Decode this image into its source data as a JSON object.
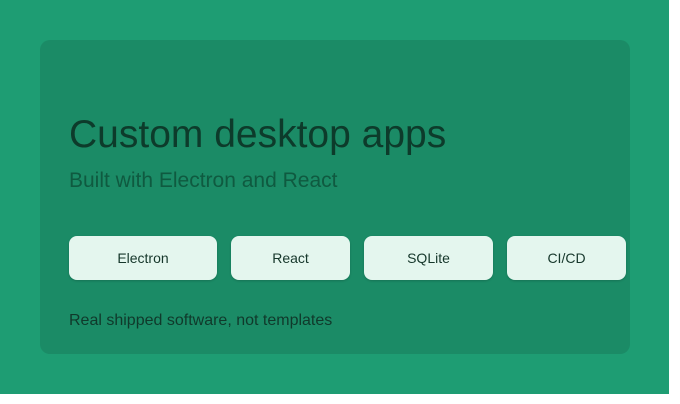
{
  "hero": {
    "title": "Custom desktop apps",
    "subtitle": "Built with Electron and React",
    "tags": [
      {
        "label": "Electron"
      },
      {
        "label": "React"
      },
      {
        "label": "SQLite"
      },
      {
        "label": "CI/CD"
      }
    ],
    "footnote": "Real shipped software, not templates"
  },
  "colors": {
    "background": "#1e9d73",
    "card": "#1b8b66",
    "chip": "#e4f6ee",
    "title_text": "#0d3b2b"
  }
}
